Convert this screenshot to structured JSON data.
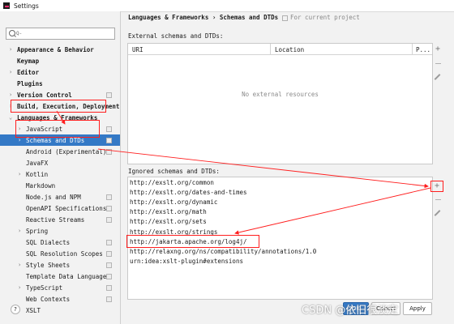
{
  "window": {
    "title": "Settings"
  },
  "search": {
    "placeholder": "Q-"
  },
  "sidebar": {
    "items": [
      {
        "label": "Appearance & Behavior",
        "bold": true,
        "expander": "collapsed",
        "level": 0
      },
      {
        "label": "Keymap",
        "bold": true,
        "expander": "none",
        "level": 0
      },
      {
        "label": "Editor",
        "bold": true,
        "expander": "collapsed",
        "level": 0
      },
      {
        "label": "Plugins",
        "bold": true,
        "expander": "none",
        "level": 0
      },
      {
        "label": "Version Control",
        "bold": true,
        "expander": "collapsed",
        "level": 0,
        "project": true
      },
      {
        "label": "Build, Execution, Deployment",
        "bold": true,
        "expander": "collapsed",
        "level": 0
      },
      {
        "label": "Languages & Frameworks",
        "bold": true,
        "expander": "expanded",
        "level": 0,
        "highlighted": true
      },
      {
        "label": "JavaScript",
        "bold": false,
        "expander": "collapsed",
        "level": 1,
        "project": true
      },
      {
        "label": "Schemas and DTDs",
        "bold": false,
        "expander": "collapsed",
        "level": 1,
        "project": true,
        "selected": true
      },
      {
        "label": "Android (Experimental)",
        "bold": false,
        "expander": "none",
        "level": 1,
        "project": true
      },
      {
        "label": "JavaFX",
        "bold": false,
        "expander": "none",
        "level": 1
      },
      {
        "label": "Kotlin",
        "bold": false,
        "expander": "collapsed",
        "level": 1
      },
      {
        "label": "Markdown",
        "bold": false,
        "expander": "none",
        "level": 1
      },
      {
        "label": "Node.js and NPM",
        "bold": false,
        "expander": "none",
        "level": 1,
        "project": true
      },
      {
        "label": "OpenAPI Specifications",
        "bold": false,
        "expander": "none",
        "level": 1,
        "project": true
      },
      {
        "label": "Reactive Streams",
        "bold": false,
        "expander": "none",
        "level": 1,
        "project": true
      },
      {
        "label": "Spring",
        "bold": false,
        "expander": "collapsed",
        "level": 1
      },
      {
        "label": "SQL Dialects",
        "bold": false,
        "expander": "none",
        "level": 1,
        "project": true
      },
      {
        "label": "SQL Resolution Scopes",
        "bold": false,
        "expander": "none",
        "level": 1,
        "project": true
      },
      {
        "label": "Style Sheets",
        "bold": false,
        "expander": "collapsed",
        "level": 1,
        "project": true
      },
      {
        "label": "Template Data Languages",
        "bold": false,
        "expander": "none",
        "level": 1,
        "project": true
      },
      {
        "label": "TypeScript",
        "bold": false,
        "expander": "collapsed",
        "level": 1,
        "project": true
      },
      {
        "label": "Web Contexts",
        "bold": false,
        "expander": "none",
        "level": 1,
        "project": true
      },
      {
        "label": "XSLT",
        "bold": false,
        "expander": "none",
        "level": 1
      }
    ]
  },
  "header": {
    "breadcrumb": "Languages & Frameworks › Schemas and DTDs",
    "project_note": "For current project"
  },
  "external": {
    "title": "External schemas and DTDs:",
    "columns": [
      "URI",
      "Location",
      "P..."
    ],
    "empty_text": "No external resources"
  },
  "ignored": {
    "title": "Ignored schemas and DTDs:",
    "items": [
      "http://exslt.org/common",
      "http://exslt.org/dates-and-times",
      "http://exslt.org/dynamic",
      "http://exslt.org/math",
      "http://exslt.org/sets",
      "http://exslt.org/strings",
      "http://jakarta.apache.org/log4j/",
      "http://relaxng.org/ns/compatibility/annotations/1.0",
      "urn:idea:xslt-plugin#extensions"
    ]
  },
  "toolbar": {
    "add": "+",
    "remove": "−"
  },
  "footer": {
    "help": "?",
    "ok_label": "OK",
    "cancel_label": "Cancel",
    "apply_label": "Apply"
  },
  "watermark": "CSDN @依旧很淡定",
  "colors": {
    "selection": "#3479c6",
    "annotation": "#ff1e1e"
  }
}
